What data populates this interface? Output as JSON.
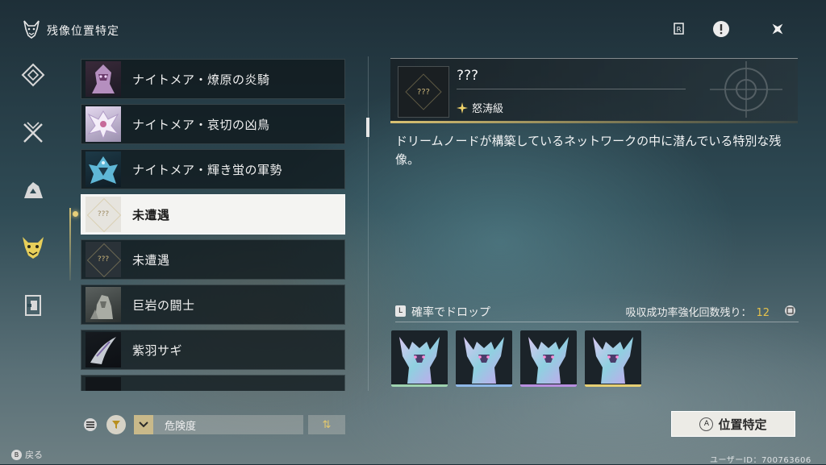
{
  "header": {
    "title": "残像位置特定",
    "title_icon": "demon-mask-icon",
    "actions": [
      {
        "name": "r-key-icon"
      },
      {
        "name": "alert-icon"
      },
      {
        "name": "close-icon"
      }
    ]
  },
  "sidebar": {
    "items": [
      {
        "name": "sidebar-item-map"
      },
      {
        "name": "sidebar-item-crossed-swords"
      },
      {
        "name": "sidebar-item-creature"
      },
      {
        "name": "sidebar-item-echo",
        "selected": true
      },
      {
        "name": "sidebar-item-domain"
      }
    ]
  },
  "list": {
    "items": [
      {
        "label": "ナイトメア・燎原の炎騎",
        "thumb": "creature-1"
      },
      {
        "label": "ナイトメア・哀切の凶鳥",
        "thumb": "creature-2"
      },
      {
        "label": "ナイトメア・輝き蛍の軍勢",
        "thumb": "creature-3"
      },
      {
        "label": "未遭遇",
        "thumb": "unknown",
        "thumb_text": "???",
        "selected": true
      },
      {
        "label": "未遭遇",
        "thumb": "unknown",
        "thumb_text": "???"
      },
      {
        "label": "巨岩の闘士",
        "thumb": "creature-4"
      },
      {
        "label": "紫羽サギ",
        "thumb": "creature-5"
      }
    ]
  },
  "controls": {
    "sort_label": "危険度",
    "sort_order_symbol": "⇅",
    "back_button": "B",
    "back_label": "戻る"
  },
  "detail": {
    "name": "???",
    "thumb_text": "???",
    "class_label": "怒涛級",
    "description": "ドリームノードが構築しているネットワークの中に潜んでいる特別な残像。"
  },
  "drops": {
    "icon_text": "L",
    "title": "確率でドロップ",
    "absorb_label": "吸収成功率強化回数残り：",
    "absorb_count": "12",
    "items": [
      {
        "rarity_color": "#9fd3b0"
      },
      {
        "rarity_color": "#8fb8e8"
      },
      {
        "rarity_color": "#b88fe0"
      },
      {
        "rarity_color": "#e6cf74"
      }
    ]
  },
  "locate": {
    "button_key": "A",
    "label": "位置特定"
  },
  "footer": {
    "user_id": "ユーザーID：700763606"
  },
  "colors": {
    "accent_gold": "#e6c24c",
    "selected_bg": "#f4f4f2"
  }
}
